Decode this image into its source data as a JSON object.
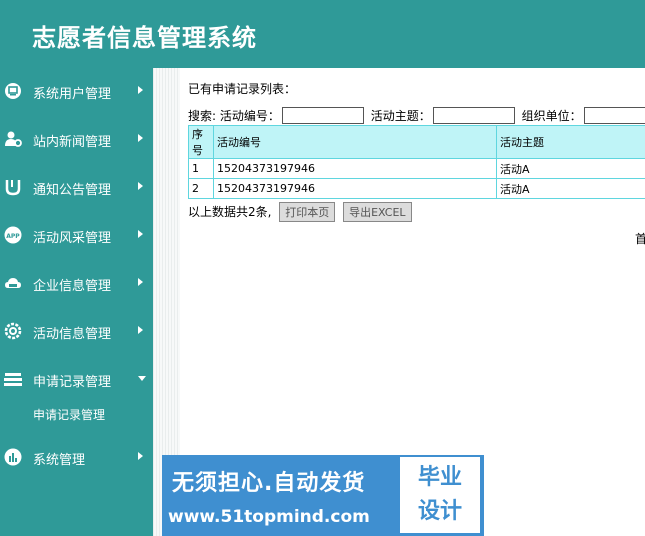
{
  "app": {
    "title": "志愿者信息管理系统"
  },
  "sidebar": {
    "items": [
      {
        "label": "系统用户管理",
        "icon": "monitor-icon"
      },
      {
        "label": "站内新闻管理",
        "icon": "user-gear-icon"
      },
      {
        "label": "通知公告管理",
        "icon": "magnet-icon"
      },
      {
        "label": "活动风采管理",
        "icon": "app-icon"
      },
      {
        "label": "企业信息管理",
        "icon": "cloud-icon"
      },
      {
        "label": "活动信息管理",
        "icon": "gear-icon"
      },
      {
        "label": "申请记录管理",
        "icon": "stack-icon",
        "expanded": true
      },
      {
        "label": "系统管理",
        "icon": "bar-chart-icon"
      }
    ],
    "sub_item": "申请记录管理"
  },
  "content": {
    "list_title": "已有申请记录列表：",
    "search": {
      "prefix": "搜索:",
      "field1_label": "活动编号：",
      "field2_label": "活动主题：",
      "field3_label": "组织单位："
    },
    "table": {
      "headers": [
        "序号",
        "活动编号",
        "活动主题"
      ],
      "rows": [
        [
          "1",
          "15204373197946",
          "活动A"
        ],
        [
          "2",
          "15204373197946",
          "活动A"
        ]
      ]
    },
    "summary": "以上数据共2条,",
    "print_button": "打印本页",
    "export_button": "导出EXCEL",
    "pager_text": "首"
  },
  "watermark": {
    "line1": "无须担心.自动发货",
    "line2": "www.51topmind.com",
    "box_line1": "毕业",
    "box_line2": "设计"
  },
  "colors": {
    "theme": "#2f9a98",
    "table_header": "#bff4f7",
    "table_border": "#5fd6df",
    "banner": "#3f8fd0"
  }
}
